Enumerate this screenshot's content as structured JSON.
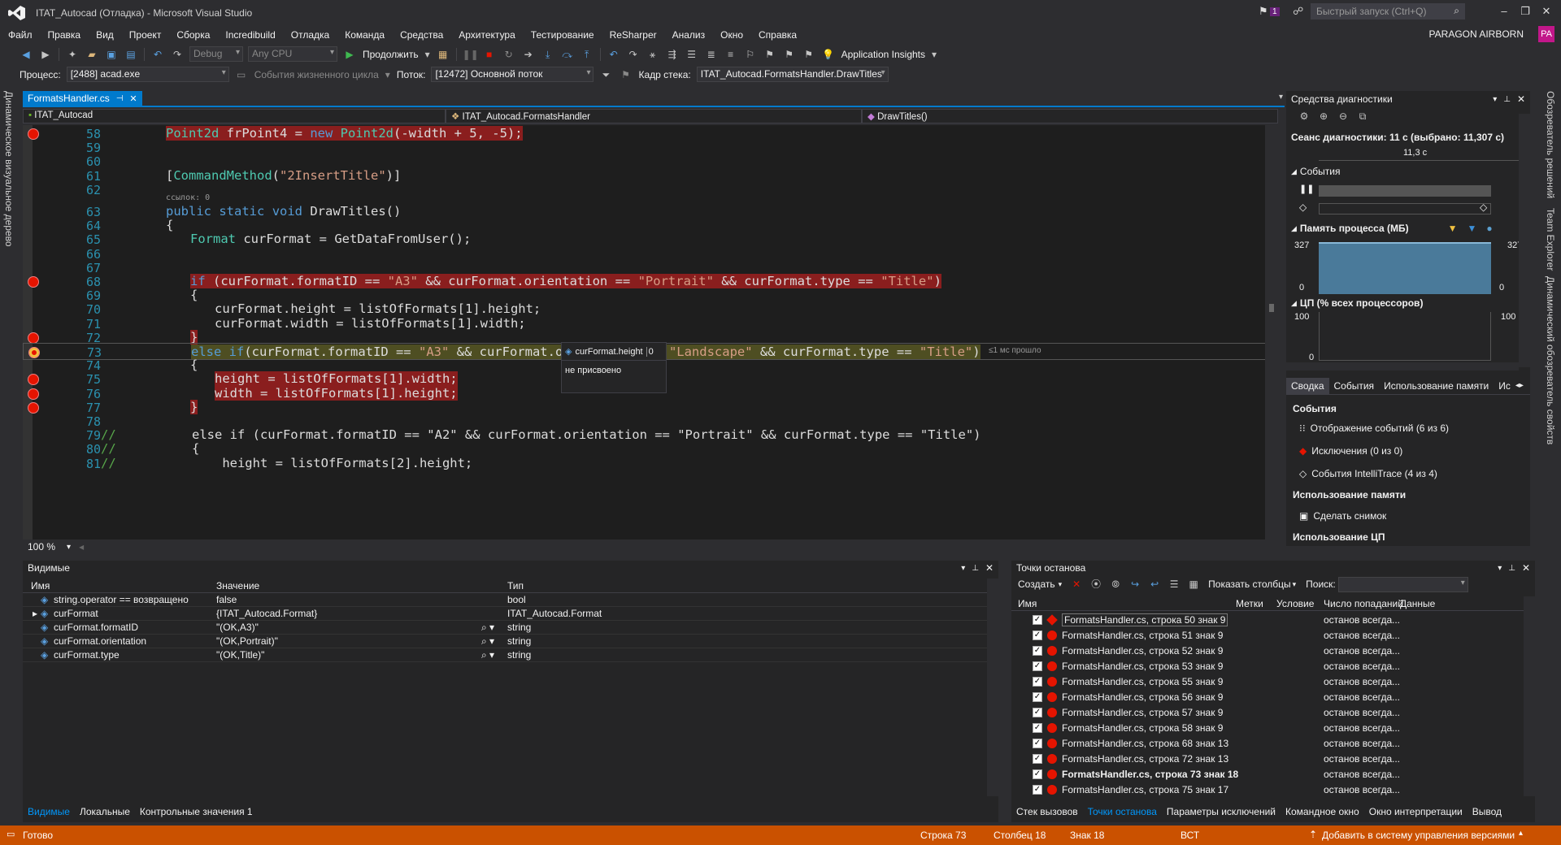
{
  "window": {
    "title": "ITAT_Autocad (Отладка) - Microsoft Visual Studio",
    "notification_count": "1",
    "quick_launch_placeholder": "Быстрый запуск (Ctrl+Q)",
    "account": "PARAGON AIRBORN",
    "avatar": "PA"
  },
  "menu": [
    "Файл",
    "Правка",
    "Вид",
    "Проект",
    "Сборка",
    "Incredibuild",
    "Отладка",
    "Команда",
    "Средства",
    "Архитектура",
    "Тестирование",
    "ReSharper",
    "Анализ",
    "Окно",
    "Справка"
  ],
  "toolbar1": {
    "config": "Debug",
    "platform": "Any CPU",
    "continue": "Продолжить",
    "app_insights": "Application Insights"
  },
  "toolbar2": {
    "process_label": "Процесс:",
    "process_value": "[2488] acad.exe",
    "lifecycle": "События жизненного цикла",
    "thread_label": "Поток:",
    "thread_value": "[12472] Основной поток",
    "stack_label": "Кадр стека:",
    "stack_value": "ITAT_Autocad.FormatsHandler.DrawTitles"
  },
  "left_strip": "Динамическое визуальное дерево",
  "right_strip": [
    "Обозреватель решений",
    "Team Explorer",
    "Динамический обозреватель свойств"
  ],
  "editor": {
    "tab": "FormatsHandler.cs",
    "nav_project": "ITAT_Autocad",
    "nav_class": "ITAT_Autocad.FormatsHandler",
    "nav_member": "DrawTitles()",
    "zoom": "100 %",
    "refs_label": "ссылок: 0",
    "elapsed": "≤1 мс прошло",
    "lines": [
      {
        "n": "58",
        "code": "Point2d frPoint4 = new Point2d(-width + 5, -5);",
        "indent": 0,
        "bp": true,
        "hl": "red"
      },
      {
        "n": "59",
        "code": "",
        "indent": 0
      },
      {
        "n": "60",
        "code": "",
        "indent": 0
      },
      {
        "n": "61",
        "code": "[CommandMethod(\"2InsertTitle\")]",
        "indent": 0
      },
      {
        "n": "62",
        "code": "",
        "indent": 0
      },
      {
        "n": "63",
        "code": "public static void DrawTitles()",
        "indent": 0
      },
      {
        "n": "64",
        "code": "{",
        "indent": 0
      },
      {
        "n": "65",
        "code": "Format curFormat = GetDataFromUser();",
        "indent": 1
      },
      {
        "n": "66",
        "code": "",
        "indent": 0
      },
      {
        "n": "67",
        "code": "",
        "indent": 0
      },
      {
        "n": "68",
        "code": "if (curFormat.formatID == \"A3\" && curFormat.orientation == \"Portrait\" && curFormat.type == \"Title\")",
        "indent": 1,
        "bp": true,
        "hl": "red"
      },
      {
        "n": "69",
        "code": "{",
        "indent": 1
      },
      {
        "n": "70",
        "code": "curFormat.height = listOfFormats[1].height;",
        "indent": 2
      },
      {
        "n": "71",
        "code": "curFormat.width = listOfFormats[1].width;",
        "indent": 2
      },
      {
        "n": "72",
        "code": "}",
        "indent": 1,
        "bp": true,
        "hl": "red"
      },
      {
        "n": "73",
        "code": "else if(curFormat.formatID == \"A3\" && curFormat.orientation == \"Landscape\" && curFormat.type == \"Title\")",
        "indent": 1,
        "bp": true,
        "hl": "yellow"
      },
      {
        "n": "74",
        "code": "{",
        "indent": 1
      },
      {
        "n": "75",
        "code": "height = listOfFormats[1].width;",
        "indent": 2,
        "bp": true,
        "hl": "red"
      },
      {
        "n": "76",
        "code": "width = listOfFormats[1].height;",
        "indent": 2,
        "bp": true,
        "hl": "red"
      },
      {
        "n": "77",
        "code": "}",
        "indent": 1,
        "bp": true,
        "hl": "red"
      },
      {
        "n": "78",
        "code": "",
        "indent": 0
      },
      {
        "n": "79",
        "code": "//          else if (curFormat.formatID == \"A2\" && curFormat.orientation == \"Portrait\" && curFormat.type == \"Title\")",
        "indent": -2,
        "comment": true
      },
      {
        "n": "80",
        "code": "//          {",
        "indent": -2,
        "comment": true
      },
      {
        "n": "81",
        "code": "//              height = listOfFormats[2].height;",
        "indent": -2,
        "comment": true
      }
    ]
  },
  "tooltip": {
    "name": "curFormat.height",
    "value": "0",
    "desc": "не присвоено"
  },
  "diagnostics": {
    "title": "Средства диагностики",
    "session": "Сеанс диагностики: 11 с (выбрано: 11,307 с)",
    "ruler": "11,3 с",
    "events": "События",
    "memory": "Память процесса (МБ)",
    "mem_max": "327",
    "mem_min": "0",
    "cpu": "ЦП (% всех процессоров)",
    "cpu_max": "100",
    "cpu_min": "0",
    "tabs": [
      "Сводка",
      "События",
      "Использование памяти",
      "Ис"
    ],
    "sec_events": "События",
    "item_show": "Отображение событий (6 из 6)",
    "item_exc": "Исключения (0 из 0)",
    "item_intelli": "События IntelliTrace (4 из 4)",
    "sec_mem": "Использование памяти",
    "item_snapshot": "Сделать снимок",
    "sec_cpu": "Использование ЦП"
  },
  "watch": {
    "title": "Видимые",
    "col_name": "Имя",
    "col_value": "Значение",
    "col_type": "Тип",
    "rows": [
      {
        "name": "string.operator == возвращено",
        "value": "false",
        "type": "bool"
      },
      {
        "name": "curFormat",
        "value": "{ITAT_Autocad.Format}",
        "type": "ITAT_Autocad.Format",
        "expand": true
      },
      {
        "name": "curFormat.formatID",
        "value": "\"(OK,A3)\"",
        "type": "string",
        "search": true
      },
      {
        "name": "curFormat.orientation",
        "value": "\"(OK,Portrait)\"",
        "type": "string",
        "search": true
      },
      {
        "name": "curFormat.type",
        "value": "\"(OK,Title)\"",
        "type": "string",
        "search": true
      }
    ],
    "tabs": [
      "Видимые",
      "Локальные",
      "Контрольные значения 1"
    ]
  },
  "breakpoints": {
    "title": "Точки останова",
    "create": "Создать",
    "show_columns": "Показать столбцы",
    "search_label": "Поиск:",
    "cols": [
      "Имя",
      "Метки",
      "Условие",
      "Число попаданий",
      "Данные"
    ],
    "rows": [
      {
        "name": "FormatsHandler.cs, строка 50 знак 9",
        "hits": "останов всегда",
        "first": true
      },
      {
        "name": "FormatsHandler.cs, строка 51 знак 9",
        "hits": "останов всегда"
      },
      {
        "name": "FormatsHandler.cs, строка 52 знак 9",
        "hits": "останов всегда"
      },
      {
        "name": "FormatsHandler.cs, строка 53 знак 9",
        "hits": "останов всегда"
      },
      {
        "name": "FormatsHandler.cs, строка 55 знак 9",
        "hits": "останов всегда"
      },
      {
        "name": "FormatsHandler.cs, строка 56 знак 9",
        "hits": "останов всегда"
      },
      {
        "name": "FormatsHandler.cs, строка 57 знак 9",
        "hits": "останов всегда"
      },
      {
        "name": "FormatsHandler.cs, строка 58 знак 9",
        "hits": "останов всегда"
      },
      {
        "name": "FormatsHandler.cs, строка 68 знак 13",
        "hits": "останов всегда"
      },
      {
        "name": "FormatsHandler.cs, строка 72 знак 13",
        "hits": "останов всегда"
      },
      {
        "name": "FormatsHandler.cs, строка 73 знак 18",
        "hits": "останов всегда",
        "bold": true
      },
      {
        "name": "FormatsHandler.cs, строка 75 знак 17",
        "hits": "останов всегда"
      }
    ],
    "tabs": [
      "Стек вызовов",
      "Точки останова",
      "Параметры исключений",
      "Командное окно",
      "Окно интерпретации",
      "Вывод"
    ]
  },
  "status": {
    "ready": "Готово",
    "line": "Строка 73",
    "col": "Столбец 18",
    "ch": "Знак 18",
    "mode": "ВСТ",
    "vcs": "Добавить в систему управления версиями"
  },
  "colors": {
    "accent": "#007acc",
    "status": "#ca5100",
    "breakpoint": "#e51400"
  }
}
